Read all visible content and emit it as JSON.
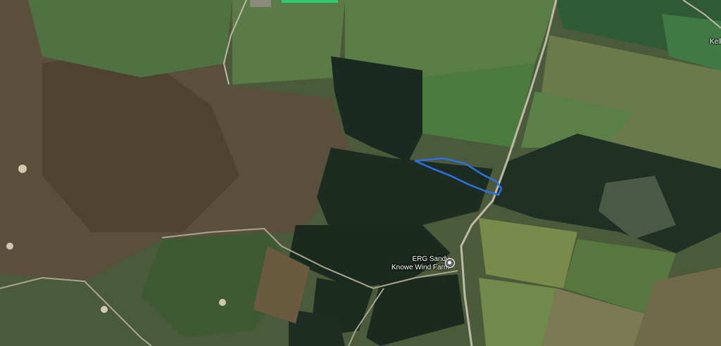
{
  "map": {
    "view": "satellite",
    "poi": {
      "name_line1": "ERG Sandy",
      "name_line2": "Knowe Wind Farm",
      "icon": "map-pin-icon"
    },
    "place_label_partial": "Kell",
    "highlight": {
      "shape": "outlined-polygon",
      "stroke_color": "#2f6fe8"
    },
    "colors": {
      "forest": "#1c2a1f",
      "moorland": "#5a4e3c",
      "pasture": "#4d6b3a",
      "road": "#bdb8a8"
    }
  }
}
